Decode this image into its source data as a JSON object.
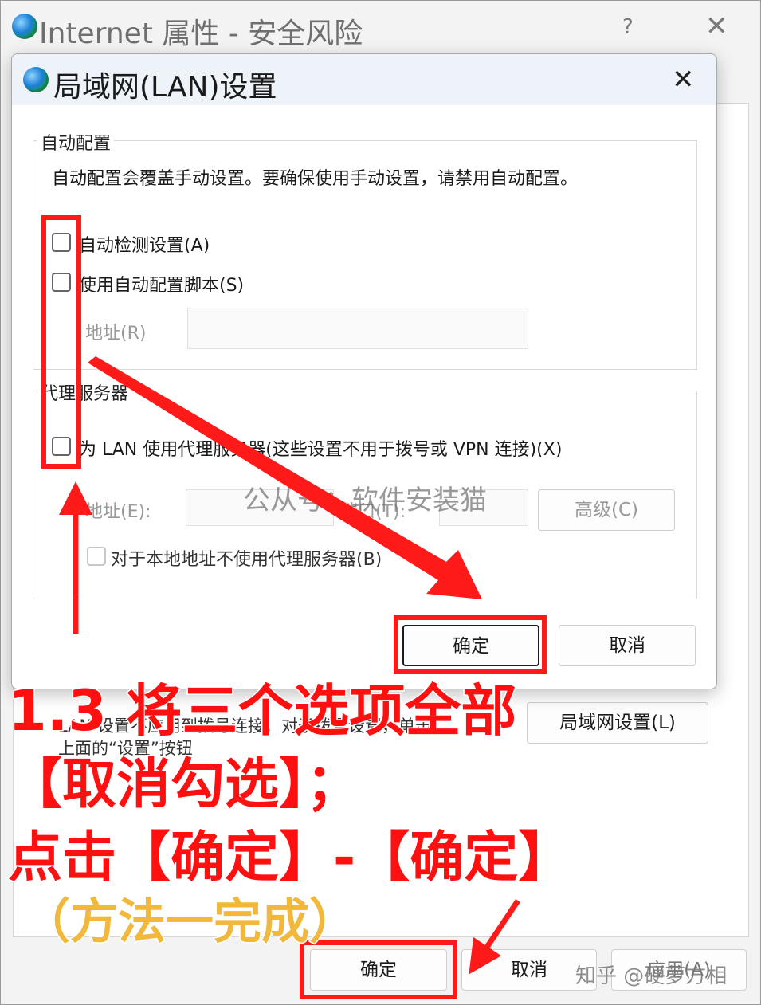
{
  "parent": {
    "title": "Internet 属性 - 安全风险",
    "help": "?",
    "close": "✕",
    "lan_text_line1": "LAN 设置不应用到拨号连接。对于拨号设置，单击",
    "lan_text_line2": "上面的“设置”按钮",
    "lan_settings_button": "局域网设置(L)",
    "ok_button": "确定",
    "cancel_button": "取消",
    "apply_button": "应用(A)"
  },
  "dialog": {
    "title": "局域网(LAN)设置",
    "close": "✕",
    "auto_config": {
      "group_label": "自动配置",
      "description": "自动配置会覆盖手动设置。要确保使用手动设置，请禁用自动配置。",
      "auto_detect_label": "自动检测设置(A)",
      "auto_detect_checked": false,
      "use_script_label": "使用自动配置脚本(S)",
      "use_script_checked": false,
      "address_label": "地址(R)",
      "address_value": ""
    },
    "proxy": {
      "group_label": "代理服务器",
      "use_proxy_label": "为 LAN 使用代理服务器(这些设置不用于拨号或 VPN 连接)(X)",
      "use_proxy_checked": false,
      "address_label": "地址(E):",
      "address_value": "",
      "port_label": "端口(T):",
      "port_value": "",
      "advanced_button": "高级(C)",
      "bypass_label": "对于本地地址不使用代理服务器(B)",
      "bypass_checked": false
    },
    "ok_button": "确定",
    "cancel_button": "取消"
  },
  "annotation": {
    "line1": "1.3 将三个选项全部",
    "line2": "【取消勾选】；",
    "line3": "点击【确定】-【确定】",
    "line4": "（方法一完成）",
    "watermark": "公从号：软件安装猫",
    "zhihu": "知乎 @硬萝方相"
  },
  "colors": {
    "annotation_red": "#ff1010",
    "annotation_yellow": "#f2b83c",
    "dialog_titlebar": "#eef3f9"
  }
}
